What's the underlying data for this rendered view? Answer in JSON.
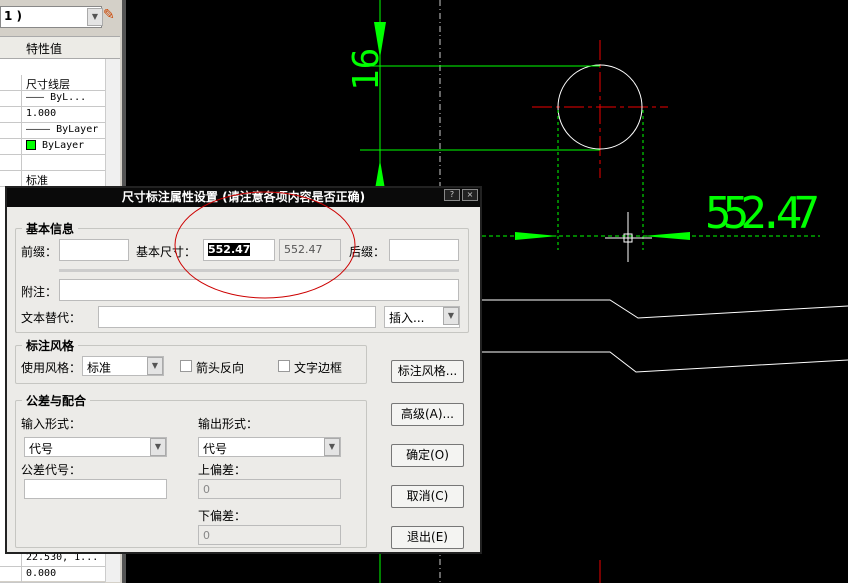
{
  "panel": {
    "combo_value": "1 )",
    "header": "特性值",
    "rows": [
      "尺寸线层",
      "——— ByL...",
      "1.000",
      "———— ByLayer",
      "ByLayer",
      "",
      "标准"
    ],
    "bottom_rows": [
      "22.530, 1...",
      "0.000"
    ],
    "bylayer_color": "#00ff00"
  },
  "dialog": {
    "title": "尺寸标注属性设置 (请注意各项内容是否正确)",
    "help": "?",
    "close": "×",
    "basic": {
      "legend": "基本信息",
      "prefix_label": "前缀：",
      "prefix": "",
      "base_label": "基本尺寸：",
      "base_value": "552.47",
      "measured": "552.47",
      "suffix_label": "后缀：",
      "suffix": "",
      "note_label": "附注：",
      "note": "",
      "override_label": "文本替代：",
      "override": "",
      "insert": "插入..."
    },
    "style": {
      "legend": "标注风格",
      "use_label": "使用风格：",
      "use_value": "标准",
      "arrow_reverse": "箭头反向",
      "text_frame": "文字边框"
    },
    "tol": {
      "legend": "公差与配合",
      "input_label": "输入形式：",
      "input_value": "代号",
      "output_label": "输出形式：",
      "output_value": "代号",
      "code_label": "公差代号：",
      "code": "",
      "upper_label": "上偏差：",
      "upper": "0",
      "lower_label": "下偏差：",
      "lower": "0"
    },
    "buttons": {
      "style": "标注风格...",
      "advanced": "高级(A)...",
      "ok": "确定(O)",
      "cancel": "取消(C)",
      "exit": "退出(E)"
    }
  },
  "canvas": {
    "dim_vertical": "16",
    "dim_horizontal": "552.47"
  }
}
